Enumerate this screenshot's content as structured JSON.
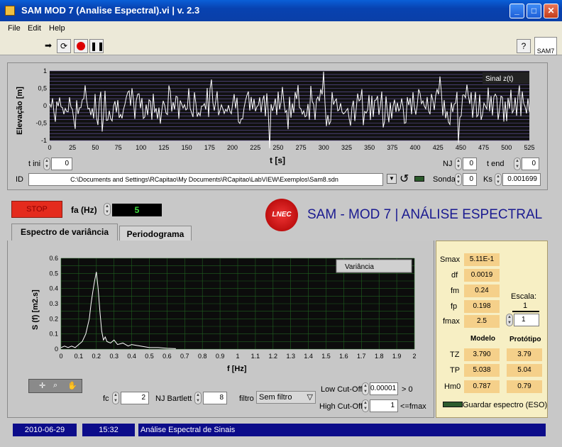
{
  "window": {
    "title": "SAM MOD 7 (Analise Espectral).vi | v. 2.3",
    "min": "_",
    "max": "□",
    "close": "✕"
  },
  "menu": {
    "file": "File",
    "edit": "Edit",
    "help": "Help"
  },
  "toolbar": {
    "run_icon": "run-arrow-icon",
    "loop_icon": "run-continuous-icon",
    "stop_icon": "abort-icon",
    "pause_icon": "pause-icon",
    "help": "?",
    "badge": "SAM7"
  },
  "signal": {
    "ylabel": "Elevação [m]",
    "xlabel": "t [s]",
    "legend": "Sinal z(t)",
    "yticks": [
      "1",
      "0,5",
      "0",
      "-0,5",
      "-1"
    ],
    "xticks": [
      "0",
      "25",
      "50",
      "75",
      "100",
      "125",
      "150",
      "175",
      "200",
      "225",
      "250",
      "275",
      "300",
      "325",
      "350",
      "375",
      "400",
      "425",
      "450",
      "475",
      "500",
      "525"
    ]
  },
  "controls_top": {
    "t_ini_label": "t ini",
    "t_ini": "0",
    "nj_label": "NJ",
    "nj": "0",
    "t_end_label": "t end",
    "t_end": "0",
    "id_label": "ID",
    "path": "C:\\Documents and Settings\\RCapitao\\My Documents\\RCapitao\\LabVIEW\\Exemplos\\Sam8.sdn",
    "sonda_label": "Sonda",
    "sonda": "0",
    "ks_label": "Ks",
    "ks": "0.001699"
  },
  "stop_label": "STOP",
  "fa": {
    "label": "fa (Hz)",
    "value": "5"
  },
  "header": {
    "logo": "LNEC",
    "title": "SAM - MOD 7  |  ANÁLISE ESPECTRAL"
  },
  "tabs": {
    "active": "Espectro de variância",
    "other": "Periodograma"
  },
  "spectrum": {
    "ylabel": "S (f) [m2.s]",
    "xlabel": "f [Hz]",
    "legend": "Variância",
    "yticks": [
      "0.6",
      "0.5",
      "0.4",
      "0.3",
      "0.2",
      "0.1",
      "0"
    ],
    "xticks": [
      "0",
      "0.1",
      "0.2",
      "0.3",
      "0.4",
      "0.5",
      "0.6",
      "0.7",
      "0.8",
      "0.9",
      "1",
      "1.1",
      "1.2",
      "1.3",
      "1.4",
      "1.5",
      "1.6",
      "1.7",
      "1.8",
      "1.9",
      "2"
    ]
  },
  "bottom_controls": {
    "fc_label": "fc",
    "fc": "2",
    "njb_label": "NJ Bartlett",
    "njb": "8",
    "filtro_label": "filtro",
    "filtro": "Sem filtro",
    "low_label": "Low Cut-Off",
    "low": "0.00001",
    "low_cond": "> 0",
    "high_label": "High Cut-Off",
    "high": "1",
    "high_cond": "<=fmax"
  },
  "stats": {
    "smax_label": "Smax",
    "smax": "5.11E-1",
    "df_label": "df",
    "df": "0.0019",
    "fm_label": "fm",
    "fm": "0.24",
    "fp_label": "fp",
    "fp": "0.198",
    "fmax_label": "fmax",
    "fmax": "2.5",
    "escala_label": "Escala:",
    "escala_num": "1",
    "escala_den": "1",
    "modelo": "Modelo",
    "prototipo": "Protótipo",
    "tz_label": "TZ",
    "tz_m": "3.790",
    "tz_p": "3.79",
    "tp_label": "TP",
    "tp_m": "5.038",
    "tp_p": "5.04",
    "hm0_label": "Hm0",
    "hm0_m": "0.787",
    "hm0_p": "0.79",
    "save_label": "Guardar espectro (ESO)"
  },
  "status": {
    "date": "2010-06-29",
    "time": "15:32",
    "text": "Análise Espectral de Sinais"
  },
  "chart_data": [
    {
      "type": "line",
      "title": "",
      "xlabel": "t [s]",
      "ylabel": "Elevação [m]",
      "xlim": [
        0,
        525
      ],
      "ylim": [
        -1,
        1
      ],
      "series": [
        {
          "name": "Sinal z(t)",
          "description_only": false,
          "values": []
        }
      ]
    },
    {
      "type": "line",
      "title": "",
      "xlabel": "f [Hz]",
      "ylabel": "S (f) [m2.s]",
      "xlim": [
        0,
        2
      ],
      "ylim": [
        0,
        0.6
      ],
      "series": [
        {
          "name": "Variância",
          "x": [
            0,
            0.02,
            0.04,
            0.06,
            0.08,
            0.1,
            0.12,
            0.14,
            0.15,
            0.16,
            0.17,
            0.18,
            0.19,
            0.2,
            0.21,
            0.22,
            0.23,
            0.24,
            0.25,
            0.26,
            0.28,
            0.3,
            0.32,
            0.35,
            0.38,
            0.4,
            0.45,
            0.5,
            0.55,
            0.6,
            0.65
          ],
          "y": [
            0.01,
            0.02,
            0.01,
            0.02,
            0.01,
            0.03,
            0.05,
            0.1,
            0.15,
            0.2,
            0.3,
            0.38,
            0.45,
            0.51,
            0.4,
            0.25,
            0.12,
            0.06,
            0.08,
            0.05,
            0.04,
            0.06,
            0.03,
            0.04,
            0.02,
            0.03,
            0.02,
            0.01,
            0.01,
            0.005,
            0.003
          ]
        }
      ]
    }
  ]
}
